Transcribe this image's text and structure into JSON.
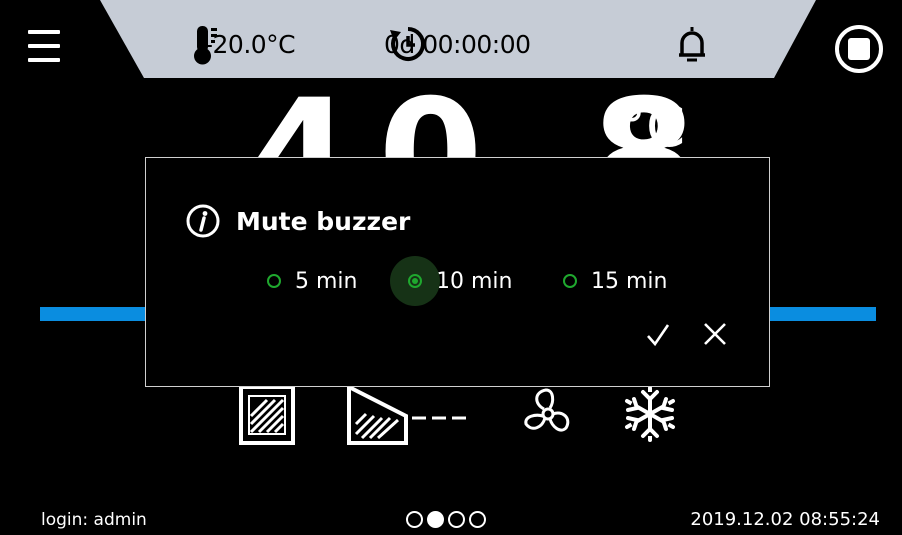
{
  "status": {
    "setpoint_temp": "-20.0°C",
    "timer": "0d 00:00:00"
  },
  "main": {
    "temperature_value": "40.8",
    "temperature_unit": "°C"
  },
  "dialog": {
    "title": "Mute buzzer",
    "options": [
      {
        "label": "5 min",
        "selected": false
      },
      {
        "label": "10 min",
        "selected": true
      },
      {
        "label": "15 min",
        "selected": false
      }
    ]
  },
  "footer": {
    "login": "login: admin",
    "datetime": "2019.12.02 08:55:24",
    "pages": 4,
    "active_page": 2
  },
  "icons": {
    "menu": "hamburger-menu-icon",
    "thermometer": "thermometer-icon",
    "timer": "timer-restart-icon",
    "alarm": "bell-icon",
    "stop": "stop-icon",
    "info": "info-icon",
    "confirm": "check-icon",
    "cancel": "close-icon",
    "chamber": "chamber-icon",
    "ramp": "ramp-icon",
    "fan": "fan-icon",
    "cooling": "snowflake-icon"
  },
  "colors": {
    "status_bar": "#c6ccd6",
    "accent_blue": "#0a8de0",
    "radio_green": "#1fa82e"
  }
}
